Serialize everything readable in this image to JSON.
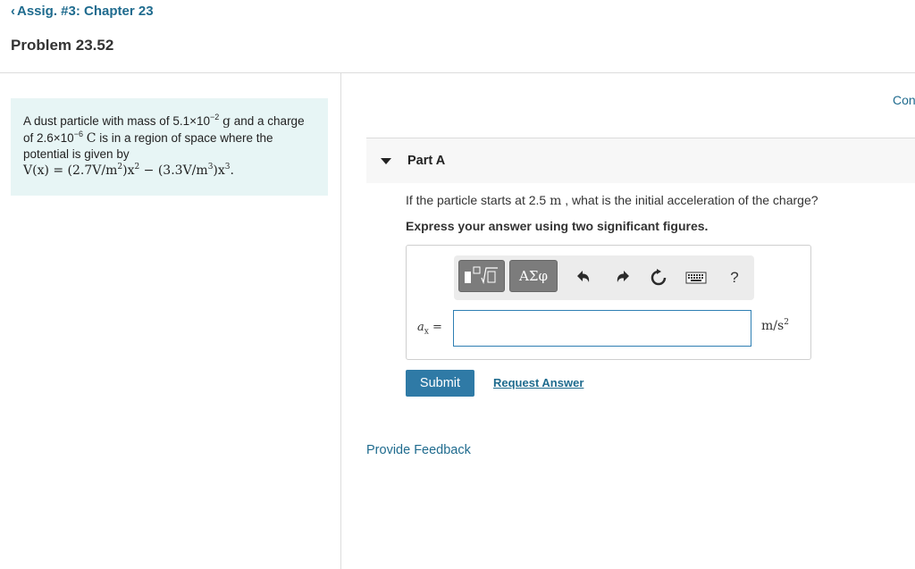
{
  "nav": {
    "back_label": "Assig. #3: Chapter 23"
  },
  "problem": {
    "title": "Problem 23.52",
    "statement_part1": "A dust particle with mass of 5.1×10",
    "mass_exp": "−2",
    "mass_unit": "g",
    "statement_part2": "and a charge of 2.6×10",
    "charge_exp": "−6",
    "charge_unit": "C",
    "statement_part3": "is in a region of space where the potential is given by",
    "potential_eq": {
      "lhs": "V(x) = (2.7V/m",
      "exp_a": "2",
      "mid1": ")x",
      "exp_b": "2",
      "mid2": " − (3.3V/m",
      "exp_c": "3",
      "mid3": ")x",
      "exp_d": "3",
      "end": "."
    }
  },
  "continue_label": "Con",
  "part": {
    "title": "Part A",
    "question_pre": "If the particle starts at 2.5",
    "question_unit": "m",
    "question_post": ", what is the initial acceleration of the charge?",
    "instruction": "Express your answer using two significant figures."
  },
  "toolbar": {
    "template_icon": "templates-icon",
    "greek_label": "ΑΣφ",
    "undo_icon": "undo-icon",
    "redo_icon": "redo-icon",
    "reset_icon": "reset-icon",
    "keyboard_icon": "keyboard-icon",
    "help_label": "?"
  },
  "answer": {
    "var_main": "a",
    "var_sub": "x",
    "var_eq": " =",
    "value": "",
    "units_base": "m/s",
    "units_exp": "2"
  },
  "actions": {
    "submit_label": "Submit",
    "request_label": "Request Answer",
    "feedback_label": "Provide Feedback"
  },
  "colors": {
    "link": "#1f6b8e",
    "submit_bg": "#2f7aa6",
    "problem_bg": "#e7f5f5",
    "input_border": "#2f7fb3"
  }
}
